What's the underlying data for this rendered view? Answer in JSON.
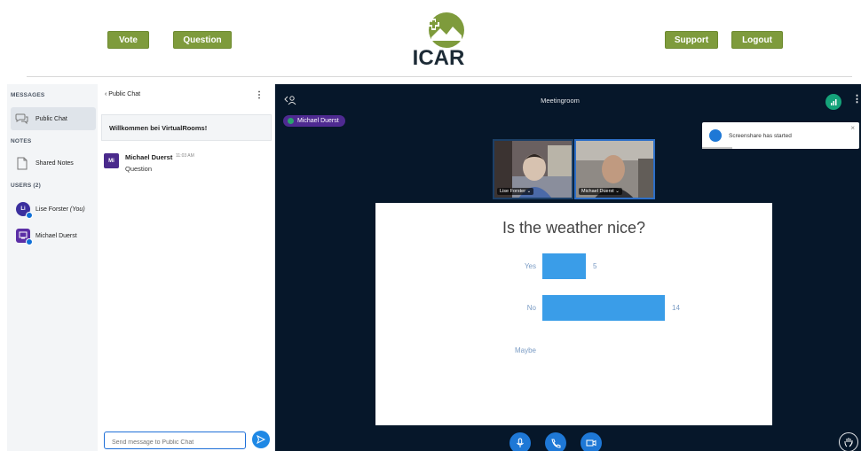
{
  "header": {
    "vote_label": "Vote",
    "question_label": "Question",
    "support_label": "Support",
    "logout_label": "Logout",
    "logo_text": "ICAR"
  },
  "sidebar": {
    "messages_heading": "MESSAGES",
    "public_chat_label": "Public Chat",
    "notes_heading": "NOTES",
    "shared_notes_label": "Shared Notes",
    "users_heading": "USERS (2)",
    "users": [
      {
        "initials": "Li",
        "name": "Lise Forster",
        "suffix": "(You)",
        "color": "#3b2f9e"
      },
      {
        "initials": "",
        "name": "Michael Duerst",
        "suffix": "",
        "color": "#5b2ea6"
      }
    ]
  },
  "chat": {
    "title": "Public Chat",
    "welcome": "Willkommen bei VirtualRooms!",
    "message": {
      "avatar": "Mi",
      "author": "Michael Duerst",
      "time": "11:03 AM",
      "text": "Question"
    },
    "input_placeholder": "Send message to Public Chat"
  },
  "room": {
    "title": "Meetingroom",
    "presenter": "Michael Duerst",
    "videos": [
      {
        "name": "Lise Forster"
      },
      {
        "name": "Michael Duerst"
      }
    ],
    "toast": "Screenshare has started"
  },
  "poll": {
    "question": "Is the weather nice?",
    "options": [
      {
        "label": "Yes",
        "votes": 5
      },
      {
        "label": "No",
        "votes": 14
      },
      {
        "label": "Maybe",
        "votes": 0
      }
    ],
    "scale_max": 14
  },
  "colors": {
    "brand_green": "#7e9b3c",
    "room_bg": "#06172a",
    "bar_blue": "#3a9de8",
    "control_blue": "#1e78d6"
  }
}
